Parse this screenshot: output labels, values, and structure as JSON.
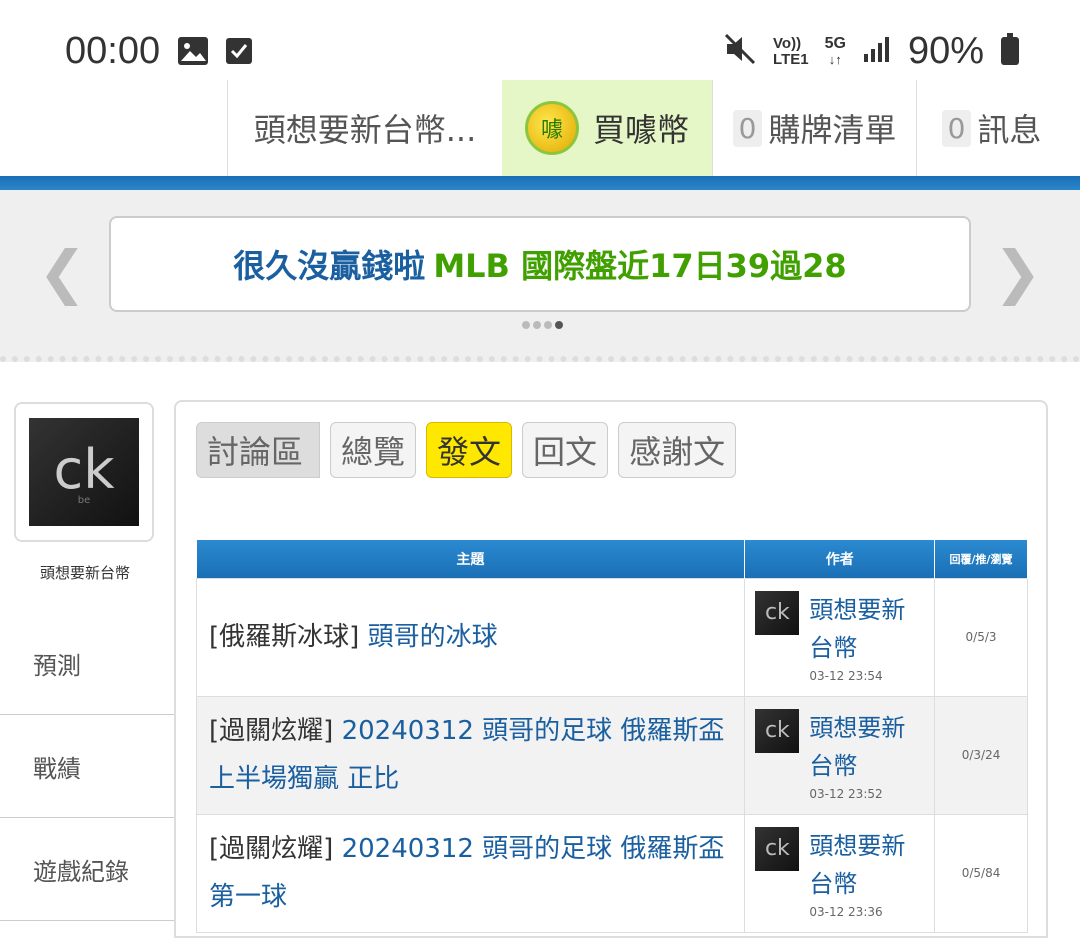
{
  "status": {
    "time": "00:00",
    "battery": "90%",
    "net_vo": "Vo))",
    "net_lte": "LTE1",
    "net_5g": "5G"
  },
  "nav": {
    "user": "頭想要新台幣...",
    "buy": "買噱幣",
    "coin_glyph": "噱",
    "cart_count": "0",
    "cart": "購牌清單",
    "msg_count": "0",
    "msg": "訊息"
  },
  "banner": {
    "part1": "很久沒贏錢啦",
    "part2": "MLB 國際盤近17日39過28"
  },
  "profile": {
    "name": "頭想要新台幣",
    "avatar_text": "ck",
    "avatar_sub": "be"
  },
  "sidebar": {
    "items": [
      {
        "label": "預測"
      },
      {
        "label": "戰績"
      },
      {
        "label": "遊戲紀錄"
      }
    ]
  },
  "tabs": [
    {
      "label": "討論區"
    },
    {
      "label": "總覽"
    },
    {
      "label": "發文"
    },
    {
      "label": "回文"
    },
    {
      "label": "感謝文"
    }
  ],
  "table": {
    "headers": [
      "主題",
      "作者",
      "回覆/推/瀏覽"
    ],
    "rows": [
      {
        "category": "[俄羅斯冰球]",
        "title": "頭哥的冰球",
        "author": "頭想要新台幣",
        "time": "03-12 23:54",
        "stats": "0/5/3"
      },
      {
        "category": "[過關炫耀]",
        "title": "20240312 頭哥的足球 俄羅斯盃 上半場獨贏 正比",
        "author": "頭想要新台幣",
        "time": "03-12 23:52",
        "stats": "0/3/24"
      },
      {
        "category": "[過關炫耀]",
        "title": "20240312 頭哥的足球 俄羅斯盃 第一球",
        "author": "頭想要新台幣",
        "time": "03-12 23:36",
        "stats": "0/5/84"
      }
    ]
  }
}
